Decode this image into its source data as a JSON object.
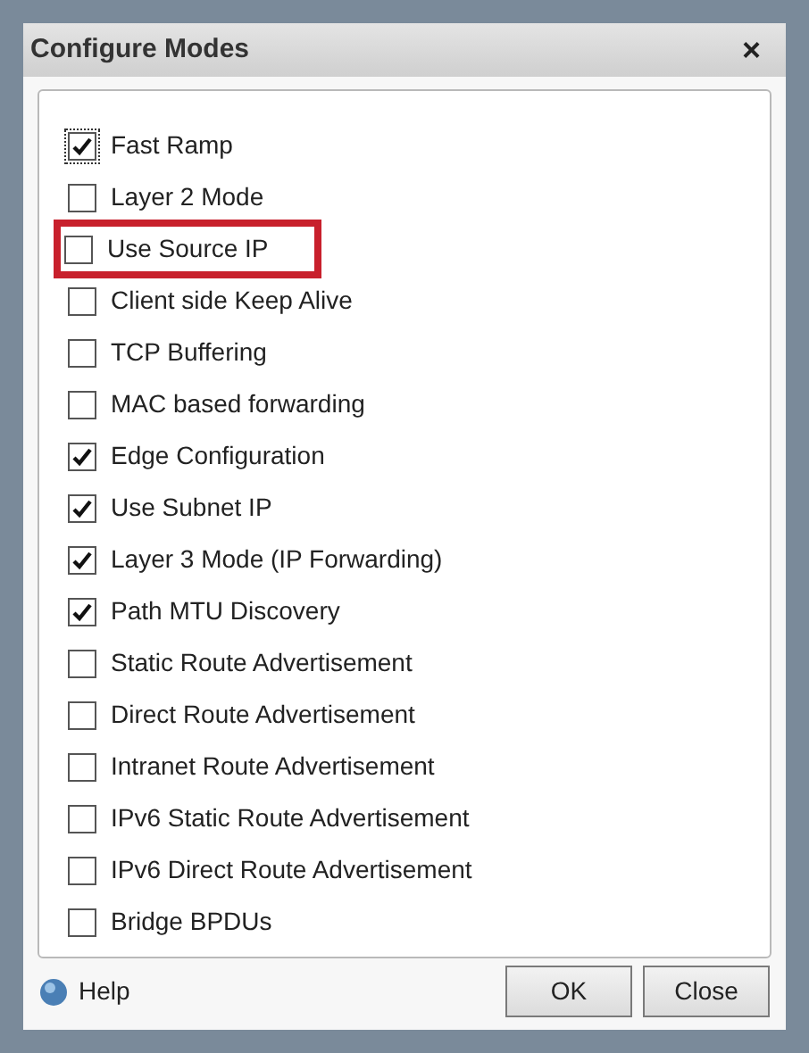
{
  "window": {
    "title": "Configure Modes",
    "close": "×"
  },
  "modes": [
    {
      "label": "Fast Ramp",
      "checked": true,
      "focused": true,
      "highlighted": false
    },
    {
      "label": "Layer 2 Mode",
      "checked": false,
      "focused": false,
      "highlighted": false
    },
    {
      "label": "Use Source IP",
      "checked": false,
      "focused": false,
      "highlighted": true
    },
    {
      "label": "Client side Keep Alive",
      "checked": false,
      "focused": false,
      "highlighted": false
    },
    {
      "label": "TCP Buffering",
      "checked": false,
      "focused": false,
      "highlighted": false
    },
    {
      "label": "MAC based forwarding",
      "checked": false,
      "focused": false,
      "highlighted": false
    },
    {
      "label": "Edge Configuration",
      "checked": true,
      "focused": false,
      "highlighted": false
    },
    {
      "label": "Use Subnet IP",
      "checked": true,
      "focused": false,
      "highlighted": false
    },
    {
      "label": "Layer 3 Mode (IP Forwarding)",
      "checked": true,
      "focused": false,
      "highlighted": false
    },
    {
      "label": "Path MTU Discovery",
      "checked": true,
      "focused": false,
      "highlighted": false
    },
    {
      "label": "Static Route Advertisement",
      "checked": false,
      "focused": false,
      "highlighted": false
    },
    {
      "label": "Direct Route Advertisement",
      "checked": false,
      "focused": false,
      "highlighted": false
    },
    {
      "label": "Intranet Route Advertisement",
      "checked": false,
      "focused": false,
      "highlighted": false
    },
    {
      "label": "IPv6 Static Route Advertisement",
      "checked": false,
      "focused": false,
      "highlighted": false
    },
    {
      "label": "IPv6 Direct Route Advertisement",
      "checked": false,
      "focused": false,
      "highlighted": false
    },
    {
      "label": "Bridge BPDUs",
      "checked": false,
      "focused": false,
      "highlighted": false
    }
  ],
  "footer": {
    "help": "Help",
    "buttons": [
      "OK",
      "Close"
    ]
  }
}
